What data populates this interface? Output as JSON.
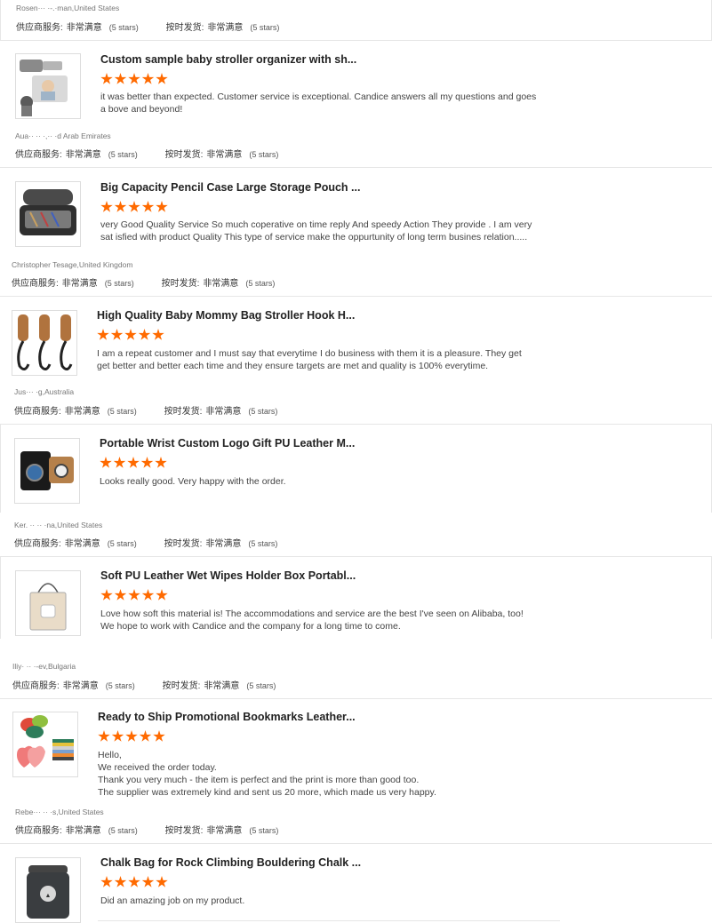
{
  "reviews": [
    {
      "reviewer": "Rosen··· ·-.·man,United States",
      "ratings": {
        "service_label": "供应商服务:",
        "service_value": "非常满意",
        "service_count": "(5 stars)",
        "ship_label": "按时发货:",
        "ship_value": "非常满意",
        "ship_count": "(5 stars)"
      }
    },
    {
      "product": "Custom sample baby stroller organizer with sh...",
      "product_icon": "stroller-organizer-icon",
      "stars": 5,
      "comment": "it was better than expected. Customer service is exceptional. Candice answers all my questions and goes a bove and beyond!",
      "reviewer": "Aua·· ·· ·,·· ·d Arab Emirates",
      "ratings": {
        "service_label": "供应商服务:",
        "service_value": "非常满意",
        "service_count": "(5 stars)",
        "ship_label": "按时发货:",
        "ship_value": "非常满意",
        "ship_count": "(5 stars)"
      }
    },
    {
      "product": "Big Capacity Pencil Case Large Storage Pouch ...",
      "product_icon": "pencil-case-icon",
      "stars": 5,
      "comment": "very Good Quality Service So much coperative on time reply And speedy Action They provide .  I am very sat isfied with product Quality This type of service make the oppurtunity of long term busines relation.....",
      "reviewer": "Christopher Tesage,United Kingdom",
      "ratings": {
        "service_label": "供应商服务:",
        "service_value": "非常满意",
        "service_count": "(5 stars)",
        "ship_label": "按时发货:",
        "ship_value": "非常满意",
        "ship_count": "(5 stars)"
      }
    },
    {
      "product": "High Quality Baby Mommy Bag Stroller Hook H...",
      "product_icon": "stroller-hook-icon",
      "stars": 5,
      "comment": "I am a repeat customer and I must say that everytime I do business with them it is a pleasure. They get get better and better each time and they ensure targets are met and quality is 100% everytime.",
      "reviewer": "Jus··· ·g,Australia",
      "ratings": {
        "service_label": "供应商服务:",
        "service_value": "非常满意",
        "service_count": "(5 stars)",
        "ship_label": "按时发货:",
        "ship_value": "非常满意",
        "ship_count": "(5 stars)"
      }
    },
    {
      "product": "Portable Wrist Custom Logo Gift PU Leather M...",
      "product_icon": "watch-box-icon",
      "stars": 5,
      "comment": "Looks really good. Very happy with the order.",
      "reviewer": "Ker. ·· ·· ·na,United States",
      "ratings": {
        "service_label": "供应商服务:",
        "service_value": "非常满意",
        "service_count": "(5 stars)",
        "ship_label": "按时发货:",
        "ship_value": "非常满意",
        "ship_count": "(5 stars)"
      }
    },
    {
      "product": "Soft PU Leather Wet Wipes Holder Box Portabl...",
      "product_icon": "wipes-holder-icon",
      "stars": 5,
      "comment": "Love how soft this material is! The accommodations and service are the best I've seen on Alibaba, too! We hope to work with Candice and the company for a long time to come.",
      "reviewer": "Iliy· ·· ·-ev,Bulgaria",
      "ratings": {
        "service_label": "供应商服务:",
        "service_value": "非常满意",
        "service_count": "(5 stars)",
        "ship_label": "按时发货:",
        "ship_value": "非常满意",
        "ship_count": "(5 stars)"
      }
    },
    {
      "product": "Ready to Ship Promotional Bookmarks Leather...",
      "product_icon": "bookmarks-icon",
      "stars": 5,
      "comment": "Hello,\nWe received the order today.\nThank you very much - the item is perfect and the print is more than good too.\nThe supplier was extremely kind and sent us 20 more, which made us very happy.",
      "reviewer": "Rebe··· ·· ·s,United States",
      "ratings": {
        "service_label": "供应商服务:",
        "service_value": "非常满意",
        "service_count": "(5 stars)",
        "ship_label": "按时发货:",
        "ship_value": "非常满意",
        "ship_count": "(5 stars)"
      }
    },
    {
      "product": "Chalk Bag for Rock Climbing Bouldering Chalk ...",
      "product_icon": "chalk-bag-icon",
      "stars": 5,
      "comment": "Did an amazing job on my product."
    }
  ],
  "colors": {
    "star": "#ff6a00",
    "divider": "#e6e6e6"
  }
}
